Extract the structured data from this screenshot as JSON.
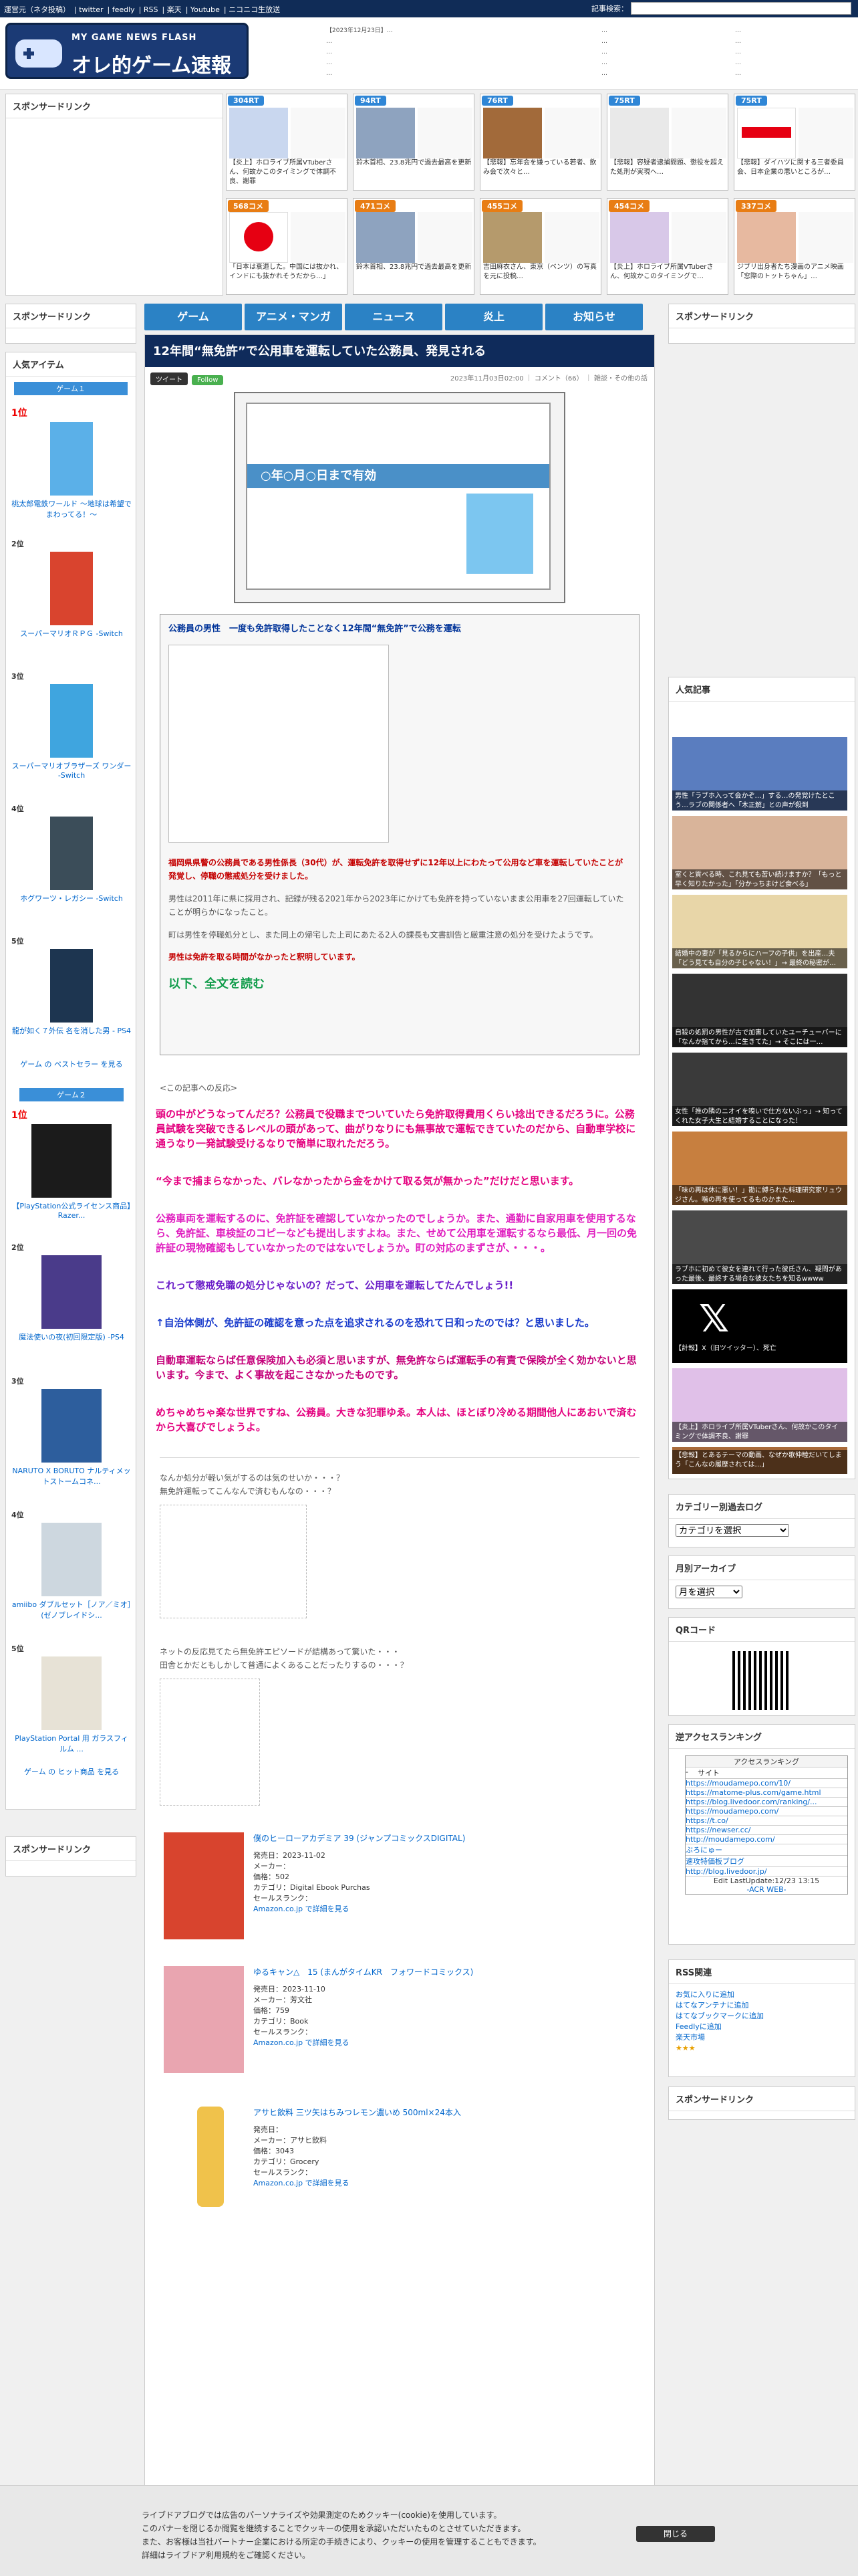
{
  "topbar": {
    "links": [
      "運営元（ネタ投稿）",
      "twitter",
      "feedly",
      "RSS",
      "楽天",
      "Youtube",
      "ニコニコ生放送"
    ],
    "search_label": "記事検索："
  },
  "header": {
    "logo_sub": "MY GAME NEWS FLASH",
    "logo_main": "オレ的ゲーム速報@JIN",
    "news_col1": [
      "【2023年12月23日】…",
      "…",
      "…",
      "…",
      "…"
    ],
    "news_col2": [
      "…",
      "…",
      "…",
      "…",
      "…"
    ],
    "news_col3": [
      "…",
      "…",
      "…",
      "…",
      "…"
    ]
  },
  "sponsored_top": "スポンサードリンク",
  "blogs": [
    {
      "tag": "304RT",
      "color": "#2f86d6",
      "text": "【炎上】ホロライブ所属VTuberさん、何故かこのタイミングで体調不良、謝罪"
    },
    {
      "tag": "94RT",
      "color": "#2f86d6",
      "text": "鈴木首相、23.8兆円で過去最高を更新"
    },
    {
      "tag": "76RT",
      "color": "#2f86d6",
      "text": "【悲報】忘年会を嫌っている若者、飲み会で次々と…"
    },
    {
      "tag": "75RT",
      "color": "#2f86d6",
      "text": "【悲報】容疑者逮捕問題、懲役を超えた処刑が実現へ…"
    },
    {
      "tag": "75RT",
      "color": "#2f86d6",
      "text": "【悲報】ダイハツに関する三者委員会、日本企業の悪いところが…"
    },
    {
      "tag": "568コメ",
      "color": "#e87d14",
      "text": "「日本は衰退した。中国には抜かれ、インドにも抜かれそうだから…」"
    },
    {
      "tag": "471コメ",
      "color": "#e87d14",
      "text": "鈴木首相、23.8兆円で過去最高を更新"
    },
    {
      "tag": "455コメ",
      "color": "#e87d14",
      "text": "吉田麻衣さん、東京（ベンツ）の写真を元に投稿…"
    },
    {
      "tag": "454コメ",
      "color": "#e87d14",
      "text": "【炎上】ホロライブ所属VTuberさん、何故かこのタイミングで…"
    },
    {
      "tag": "337コメ",
      "color": "#e87d14",
      "text": "ジブリ出身者たち漫画のアニメ映画「窓際のトットちゃん」…"
    }
  ],
  "left": {
    "sponsored": "スポンサードリンク",
    "popular_title": "人気アイテム",
    "game1_label": "ゲーム１",
    "game1_items": [
      {
        "rank": "1位",
        "name": "桃太郎電鉄ワールド ～地球は希望でまわってる！～"
      },
      {
        "rank": "2位",
        "name": "スーパーマリオＲＰＧ -Switch"
      },
      {
        "rank": "3位",
        "name": "スーパーマリオブラザーズ ワンダー -Switch"
      },
      {
        "rank": "4位",
        "name": "ホグワーツ・レガシー -Switch"
      },
      {
        "rank": "5位",
        "name": "龍が如く７外伝 名を消した男 - PS4"
      }
    ],
    "game1_more": "ゲーム の ベストセラー を見る",
    "game2_label": "ゲーム２",
    "game2_items": [
      {
        "rank": "1位",
        "name": "【PlayStation公式ライセンス商品】Razer..."
      },
      {
        "rank": "2位",
        "name": "魔法使いの夜(初回限定版) -PS4"
      },
      {
        "rank": "3位",
        "name": "NARUTO X BORUTO ナルティメットストームコネ..."
      },
      {
        "rank": "4位",
        "name": "amiibo ダブルセット［ノア／ミオ］(ゼノブレイドシ..."
      },
      {
        "rank": "5位",
        "name": "PlayStation Portal 用 ガラスフィルム ..."
      }
    ],
    "game2_more": "ゲーム の ヒット商品 を見る",
    "sponsored2": "スポンサードリンク"
  },
  "nav": [
    "ゲーム",
    "アニメ・マンガ",
    "ニュース",
    "炎上",
    "お知らせ"
  ],
  "article": {
    "title": "12年間“無免許”で公用車を運転していた公務員、発見される",
    "meta": "2023年11月03日02:00 ｜ コメント（66） ｜ 雑談・その他の話",
    "tweet": "ツイート",
    "follow": "Follow",
    "license_text": "○年○月○日まで有効",
    "quote_title": "公務員の男性　一度も免許取得したことなく12年間“無免許”で公務を運転",
    "quote_red": "福岡県県警の公務員である男性係長（30代）が、運転免許を取得せずに12年以上にわたって公用など車を運転していたことが発覚し、停職の懲戒処分を受けました。",
    "quote_p1": "男性は2011年に県に採用され、記録が残る2021年から2023年にかけても免許を持っていないまま公用車を27回運転していたことが明らかになったこと。",
    "quote_p2": "町は男性を停職処分とし、また同上の帰宅した上司にあたる2人の課長も文書訓告と厳重注意の処分を受けたようです。",
    "quote_red2": "男性は免許を取る時間がなかったと釈明しています。",
    "read_more": "以下、全文を読む",
    "reaction_head": "<この記事への反応>",
    "reactions": [
      "頭の中がどうなってんだろ？公務員で役職までついていたら免許取得費用くらい捻出できるだろうに。公務員試験を突破できるレベルの頭があって、曲がりなりにも無事故で運転できていたのだから、自動車学校に通うなり一発試験受けるなりで簡単に取れただろう。",
      "“今まで捕まらなかった、バレなかったから金をかけて取る気が無かった”だけだと思います。",
      "公務車両を運転するのに、免許証を確認していなかったのでしょうか。また、通勤に自家用車を使用するなら、免許証、車検証のコピーなども提出しますよね。また、せめて公用車を運転するなら最低、月一回の免許証の現物確認もしていなかったのではないでしょうか。町の対応のまずさが、・・・。",
      "これって懲戒免職の処分じゃないの？だって、公用車を運転してたんでしょう!!",
      "↑自治体側が、免許証の確認を意った点を追求されるのを恐れて日和ったのでは？と思いました。",
      "自動車運転ならば任意保険加入も必須と思いますが、無免許ならば運転手の有責で保険が全く効かないと思います。今まで、よく事故を起こさなかったものです。",
      "めちゃめちゃ楽な世界ですね、公務員。大きな犯罪ゆゑ。本人は、ほとぼり冷める期間他人にあおいで済むから大喜びでしょうよ。"
    ],
    "aa_text1": "なんか処分が軽い気がするのは気のせいか・・・？\n無免許運転ってこんなんで済むもんなの・・・？",
    "aa_text2": "ネットの反応見てたら無免許エピソードが結構あって驚いた・・・\n田舎とかだともしかして普通によくあることだったりするの・・・？",
    "products": [
      {
        "title": "僕のヒーローアカデミア 39 (ジャンプコミックスDIGITAL)",
        "info": [
          "発売日：2023-11-02",
          "メーカー：",
          "価格：502",
          "カテゴリ：Digital Ebook Purchas",
          "セールスランク："
        ],
        "link": "Amazon.co.jp で詳細を見る"
      },
      {
        "title": "ゆるキャン△　15 (まんがタイムKR　フォワードコミックス)",
        "info": [
          "発売日：2023-11-10",
          "メーカー：芳文社",
          "価格：759",
          "カテゴリ：Book",
          "セールスランク："
        ],
        "link": "Amazon.co.jp で詳細を見る"
      },
      {
        "title": "アサヒ飲料 三ツ矢はちみつレモン濃いめ 500ml×24本入",
        "info": [
          "発売日：",
          "メーカー：アサヒ飲料",
          "価格：3043",
          "カテゴリ：Grocery",
          "セールスランク："
        ],
        "link": "Amazon.co.jp で詳細を見る"
      }
    ]
  },
  "right": {
    "sponsored": "スポンサードリンク",
    "popular_title": "人気記事",
    "items": [
      "男性「ラブホ入って会かぞ…」する…の発覚けたとこう…ラブの関係者へ「木正解」との声が殺到",
      "室くと質べる時、これ見ても苦い続けますか？「もっと早く知りたかった」「分かっちまけど食べる」",
      "結婚中の妻が「見るからにハーフの子供」を出産…夫「どう見ても自分の子じゃない！」→ 最終の秘密が…",
      "自殺の処罰の男性が古で加害していたユーチューバーに「なんか捨てから…に生きてた」→ そこには一…",
      "女性「推の隣のニオイを嗅いで仕方ないぶっ」→ 知ってくれた女子大生と結婚することになった！",
      "「味の再は休に悪い！」勘に縛られた料理研究家リュウジさん。噛の再を使ってるものかまた…",
      "ラブホに初めて彼女を連れて行った彼氏さん、疑問があった最後、最終する場合な彼女たちを知るwwww",
      "【計報】X（旧ツイッター）、死亡",
      "【炎上】ホロライブ所属VTuberさん、何故かこのタイミングで体調不良、謝罪",
      "【悲報】とあるテーマの動画、なぜか歌仲睦だいてしまう「こんなの履歴されては…」"
    ],
    "category_title": "カテゴリー別過去ログ",
    "category_select": "カテゴリを選択",
    "archive_title": "月別アーカイブ",
    "archive_select": "月を選択",
    "qr_title": "QRコード",
    "ranking_title": "逆アクセスランキング",
    "ranking_head": "アクセスランキング",
    "ranking_cols": [
      "-",
      "サイト"
    ],
    "ranking_items": [
      "https://moudamepo.com/10/",
      "https://matome-plus.com/game.html",
      "https://blog.livedoor.com/ranking/...",
      "https://moudamepo.com/",
      "https://t.co/",
      "https://newser.cc/",
      "http://moudamepo.com/",
      "ぶろにゅー",
      "速攻特価板ブログ",
      "http://blog.livedoor.jp/"
    ],
    "ranking_footer": "Edit LastUpdate:12/23 13:15",
    "ranking_brand": "-ACR WEB-",
    "rss_title": "RSS関連",
    "rss_links": [
      "お気に入りに追加",
      "はてなアンテナに追加",
      "はてなブックマークに追加",
      "Feedlyに追加",
      "楽天市場"
    ],
    "sponsored2": "スポンサードリンク"
  },
  "cookie": {
    "line1": "ライブドアブログでは広告のパーソナライズや効果測定のためクッキー(cookie)を使用しています。",
    "line2": "このバナーを閉じるか閲覧を継続することでクッキーの使用を承認いただいたものとさせていただきます。",
    "line3": "また、お客様は当社パートナー企業における所定の手続きにより、クッキーの使用を管理することもできます。",
    "line4": "詳細はライブドア利用規約をご確認ください。",
    "close": "閉じる"
  }
}
